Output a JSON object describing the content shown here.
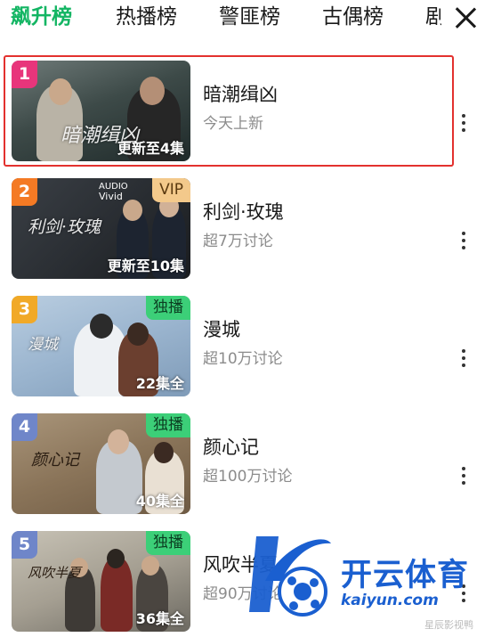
{
  "tabs": {
    "items": [
      {
        "label": "飙升榜",
        "active": true
      },
      {
        "label": "热播榜",
        "active": false
      },
      {
        "label": "警匪榜",
        "active": false
      },
      {
        "label": "古偶榜",
        "active": false
      },
      {
        "label": "剧",
        "active": false
      }
    ]
  },
  "list": [
    {
      "rank": "1",
      "rank_color": "#e8357b",
      "poster_title": "暗潮缉凶",
      "episodes": "更新至4集",
      "title": "暗潮缉凶",
      "subtitle": "今天上新",
      "highlighted": true
    },
    {
      "rank": "2",
      "rank_color": "#f47a24",
      "badge": "VIP",
      "audio_line1": "AUDIO",
      "audio_line2": "Vivid",
      "poster_title": "利剑·玫瑰",
      "episodes": "更新至10集",
      "title": "利剑·玫瑰",
      "subtitle": "超7万讨论"
    },
    {
      "rank": "3",
      "rank_color": "#f1a927",
      "badge": "独播",
      "poster_title": "漫城",
      "episodes": "22集全",
      "title": "漫城",
      "subtitle": "超10万讨论"
    },
    {
      "rank": "4",
      "rank_color": "#6f86c9",
      "badge": "独播",
      "poster_title": "颜心记",
      "episodes": "40集全",
      "title": "颜心记",
      "subtitle": "超100万讨论"
    },
    {
      "rank": "5",
      "rank_color": "#6f86c9",
      "badge": "独播",
      "poster_title": "风吹半夏",
      "episodes": "36集全",
      "title": "风吹半夏",
      "subtitle": "超90万讨论"
    }
  ],
  "watermark": {
    "brand": "开云体育",
    "url": "kaiyun.com",
    "corner": "星辰影视鸭"
  },
  "colors": {
    "accent_green": "#13b563",
    "highlight_border": "#e3312e"
  }
}
